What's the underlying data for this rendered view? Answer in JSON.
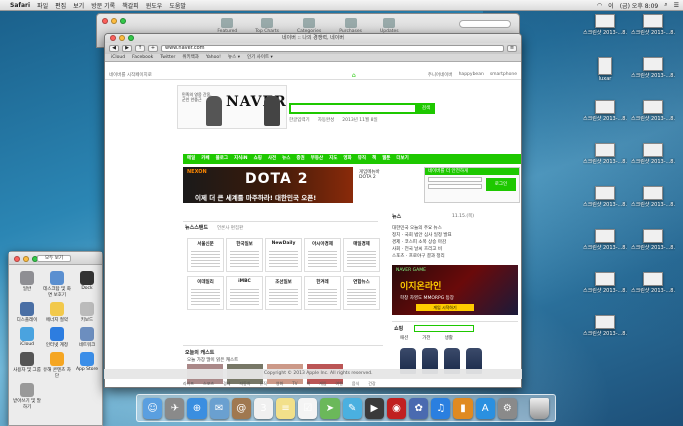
{
  "menubar": {
    "apple": "",
    "items": [
      "Safari",
      "파일",
      "편집",
      "보기",
      "방문 기록",
      "책갈피",
      "윈도우",
      "도움말"
    ],
    "clock": "(금) 오후 8:09",
    "user": "이",
    "search_icon": "magnifier"
  },
  "desktop": {
    "files": [
      {
        "label": "스크린샷 2013-...8.07.52"
      },
      {
        "label": "스크린샷 2013-...8.04.32"
      },
      {
        "label": "luxar"
      },
      {
        "label": "스크린샷 2013-...8.04.24"
      },
      {
        "label": "스크린샷 2013-...8.04.25"
      },
      {
        "label": "스크린샷 2013-...8.04.51"
      },
      {
        "label": "스크린샷 2013-...8.09.00"
      },
      {
        "label": "스크린샷 2013-...8.04.50"
      },
      {
        "label": "스크린샷 2013-...8.06.05"
      },
      {
        "label": "스크린샷 2013-...8.06.15"
      },
      {
        "label": "스크린샷 2013-...8.06.11"
      },
      {
        "label": "스크린샷 2013-...8.06.48"
      },
      {
        "label": "스크린샷 2013-...8.06.59"
      },
      {
        "label": "스크린샷 2013-...8.07.03"
      },
      {
        "label": "스크린샷 2013-...8.07.22"
      }
    ]
  },
  "back_window": {
    "toolbar": [
      "Featured",
      "Top Charts",
      "Categories",
      "Purchases",
      "Updates"
    ]
  },
  "prefs": {
    "show_all": "모두 보기",
    "items": [
      {
        "label": "일반",
        "color": "#8e8e93"
      },
      {
        "label": "데스크탑 및 화면 보호기",
        "color": "#5a8fd0"
      },
      {
        "label": "Dock",
        "color": "#333"
      },
      {
        "label": "디스플레이",
        "color": "#4a6fa5"
      },
      {
        "label": "에너지 절약",
        "color": "#f2c94c"
      },
      {
        "label": "키보드",
        "color": "#bbb"
      },
      {
        "label": "iCloud",
        "color": "#4aa3df"
      },
      {
        "label": "인터넷 계정",
        "color": "#2d7de0"
      },
      {
        "label": "네트워크",
        "color": "#6c8ebf"
      },
      {
        "label": "사용자 및 그룹",
        "color": "#555"
      },
      {
        "label": "유해 콘텐츠 차단",
        "color": "#f5a623"
      },
      {
        "label": "App Store",
        "color": "#3b8ee8"
      },
      {
        "label": "받아쓰기 및 말하기",
        "color": "#999"
      }
    ]
  },
  "safari": {
    "title": "네이버 :: 나의 경쟁력, 네이버",
    "url": "www.naver.com",
    "bookmarks": [
      "iCloud",
      "Facebook",
      "Twitter",
      "위키백과",
      "Yahoo!",
      "뉴스 ▾",
      "인기 사이트 ▾"
    ],
    "tabs": [
      "네이버 :: 나의 경쟁력, 네이버"
    ],
    "nav_left": "네이버를 시작페이지로",
    "nav_right": [
      "주니어네이버",
      "happybean",
      "smartphone"
    ],
    "doodle_caption": "민족의 영웅 간옹, 군인 안중근",
    "logo": "NAVER",
    "search_button": "검색",
    "under_search": [
      "한글입력기",
      "자동완성",
      "2013년 11월 8일"
    ],
    "menu": [
      "메일",
      "카페",
      "블로그",
      "지식iN",
      "쇼핑",
      "사전",
      "뉴스",
      "증권",
      "부동산",
      "지도",
      "영화",
      "뮤직",
      "책",
      "웹툰",
      "더보기"
    ],
    "ad": {
      "nexon": "NEXON",
      "title": "DOTA 2",
      "tagline": "이제 더 큰 세계를 마주하라! 대한민국 오픈!"
    },
    "ad_side": [
      "게임메뉴바",
      "DOTA 2"
    ],
    "login": {
      "header": "네이버를 더 안전하게",
      "button": "로그인"
    },
    "newsstand_title": "뉴스스탠드",
    "newsstand_sub": "언론사 편집판",
    "news_brands": [
      "서울신문",
      "한국일보",
      "NewDaily",
      "아시아경제",
      "매일경제",
      "이데일리",
      "iMBC",
      "조선일보",
      "한겨레",
      "연합뉴스"
    ],
    "right_title": "뉴스",
    "right_date": "11.15.(목)",
    "right_list": [
      "대한민국 오늘의 주요 뉴스",
      "정치 · 국회 법안 심사 일정 발표",
      "경제 · 코스피 소폭 상승 마감",
      "사회 · 전국 날씨 흐리고 비",
      "스포츠 · 프로야구 결과 정리"
    ],
    "ad2": {
      "game": "NAVER GAME",
      "title": "이지온라인",
      "sub": "학창 차영도 MMORPG 등장",
      "button": "게임 시작하기"
    },
    "shop_title": "쇼핑",
    "shop_tabs": [
      "패션",
      "가전",
      "생활"
    ],
    "today_title": "오늘의 캐스트",
    "today_sub": "오늘 가장 많이 읽은 캐스트",
    "bottom": [
      "라이프",
      "스포츠",
      "경제",
      "자동차",
      "뮤직",
      "영화",
      "TV",
      "책",
      "게임",
      "여행",
      "음식",
      "건강"
    ],
    "footer": "Copyright © 2013 Apple Inc. All rights reserved."
  },
  "dock": {
    "apps": [
      {
        "name": "Finder",
        "color": "#5a9fe0",
        "glyph": "☺"
      },
      {
        "name": "Launchpad",
        "color": "#8a8a8a",
        "glyph": "✈"
      },
      {
        "name": "Safari",
        "color": "#3a8ee0",
        "glyph": "⊕"
      },
      {
        "name": "Mail",
        "color": "#6aa0d0",
        "glyph": "✉"
      },
      {
        "name": "Contacts",
        "color": "#a07850",
        "glyph": "@"
      },
      {
        "name": "Calendar",
        "color": "#f0f0f0",
        "glyph": "3"
      },
      {
        "name": "Notes",
        "color": "#f2e08a",
        "glyph": "≡"
      },
      {
        "name": "Reminders",
        "color": "#f4f4f4",
        "glyph": "☑"
      },
      {
        "name": "Maps",
        "color": "#6bb85a",
        "glyph": "➤"
      },
      {
        "name": "Messages",
        "color": "#4ab0e0",
        "glyph": "✎"
      },
      {
        "name": "FaceTime",
        "color": "#3a3a3a",
        "glyph": "▶"
      },
      {
        "name": "Photo Booth",
        "color": "#c02020",
        "glyph": "◉"
      },
      {
        "name": "iPhoto",
        "color": "#4a6ab0",
        "glyph": "✿"
      },
      {
        "name": "iTunes",
        "color": "#2a7fe0",
        "glyph": "♫"
      },
      {
        "name": "iBooks",
        "color": "#e08a20",
        "glyph": "▮"
      },
      {
        "name": "App Store",
        "color": "#2a90e0",
        "glyph": "A"
      },
      {
        "name": "System Preferences",
        "color": "#8a8a8a",
        "glyph": "⚙"
      }
    ],
    "trash": "Trash"
  }
}
